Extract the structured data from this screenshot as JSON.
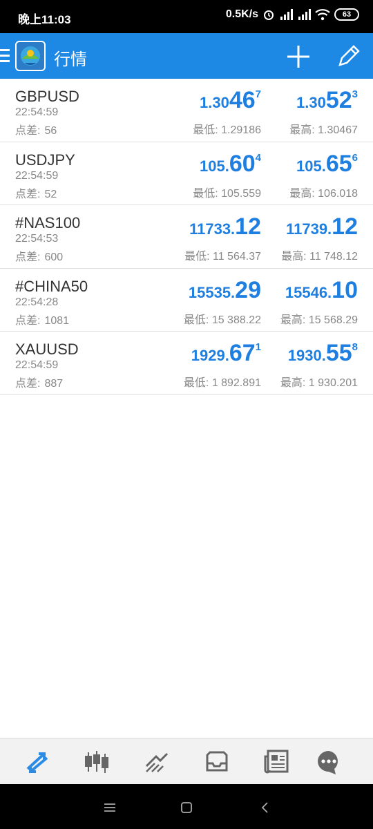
{
  "status_bar": {
    "time": "晚上11:03",
    "network_speed": "0.5K/s",
    "battery": "63"
  },
  "app_bar": {
    "title": "行情"
  },
  "quotes": [
    {
      "symbol": "GBPUSD",
      "time": "22:54:59",
      "spread_label": "点差:",
      "spread": "56",
      "bid": {
        "small": "1.30",
        "big": "46",
        "sup": "7"
      },
      "ask": {
        "small": "1.30",
        "big": "52",
        "sup": "3"
      },
      "low": "最低: 1.29186",
      "high": "最高: 1.30467"
    },
    {
      "symbol": "USDJPY",
      "time": "22:54:59",
      "spread_label": "点差:",
      "spread": "52",
      "bid": {
        "small": "105.",
        "big": "60",
        "sup": "4"
      },
      "ask": {
        "small": "105.",
        "big": "65",
        "sup": "6"
      },
      "low": "最低: 105.559",
      "high": "最高: 106.018"
    },
    {
      "symbol": "#NAS100",
      "time": "22:54:53",
      "spread_label": "点差:",
      "spread": "600",
      "bid": {
        "small": "11733.",
        "big": "12",
        "sup": ""
      },
      "ask": {
        "small": "11739.",
        "big": "12",
        "sup": ""
      },
      "low": "最低: 11 564.37",
      "high": "最高: 11 748.12"
    },
    {
      "symbol": "#CHINA50",
      "time": "22:54:28",
      "spread_label": "点差:",
      "spread": "1081",
      "bid": {
        "small": "15535.",
        "big": "29",
        "sup": ""
      },
      "ask": {
        "small": "15546.",
        "big": "10",
        "sup": ""
      },
      "low": "最低: 15 388.22",
      "high": "最高: 15 568.29"
    },
    {
      "symbol": "XAUUSD",
      "time": "22:54:59",
      "spread_label": "点差:",
      "spread": "887",
      "bid": {
        "small": "1929.",
        "big": "67",
        "sup": "1"
      },
      "ask": {
        "small": "1930.",
        "big": "55",
        "sup": "8"
      },
      "low": "最低: 1 892.891",
      "high": "最高: 1 930.201"
    }
  ],
  "bottom_nav": [
    {
      "name": "quotes-icon",
      "active": true
    },
    {
      "name": "chart-icon",
      "active": false
    },
    {
      "name": "trade-icon",
      "active": false
    },
    {
      "name": "history-icon",
      "active": false
    },
    {
      "name": "news-icon",
      "active": false
    },
    {
      "name": "chat-icon",
      "active": false
    }
  ],
  "colors": {
    "accent": "#1e88e5",
    "price": "#1e7fe0",
    "muted": "#888888"
  }
}
